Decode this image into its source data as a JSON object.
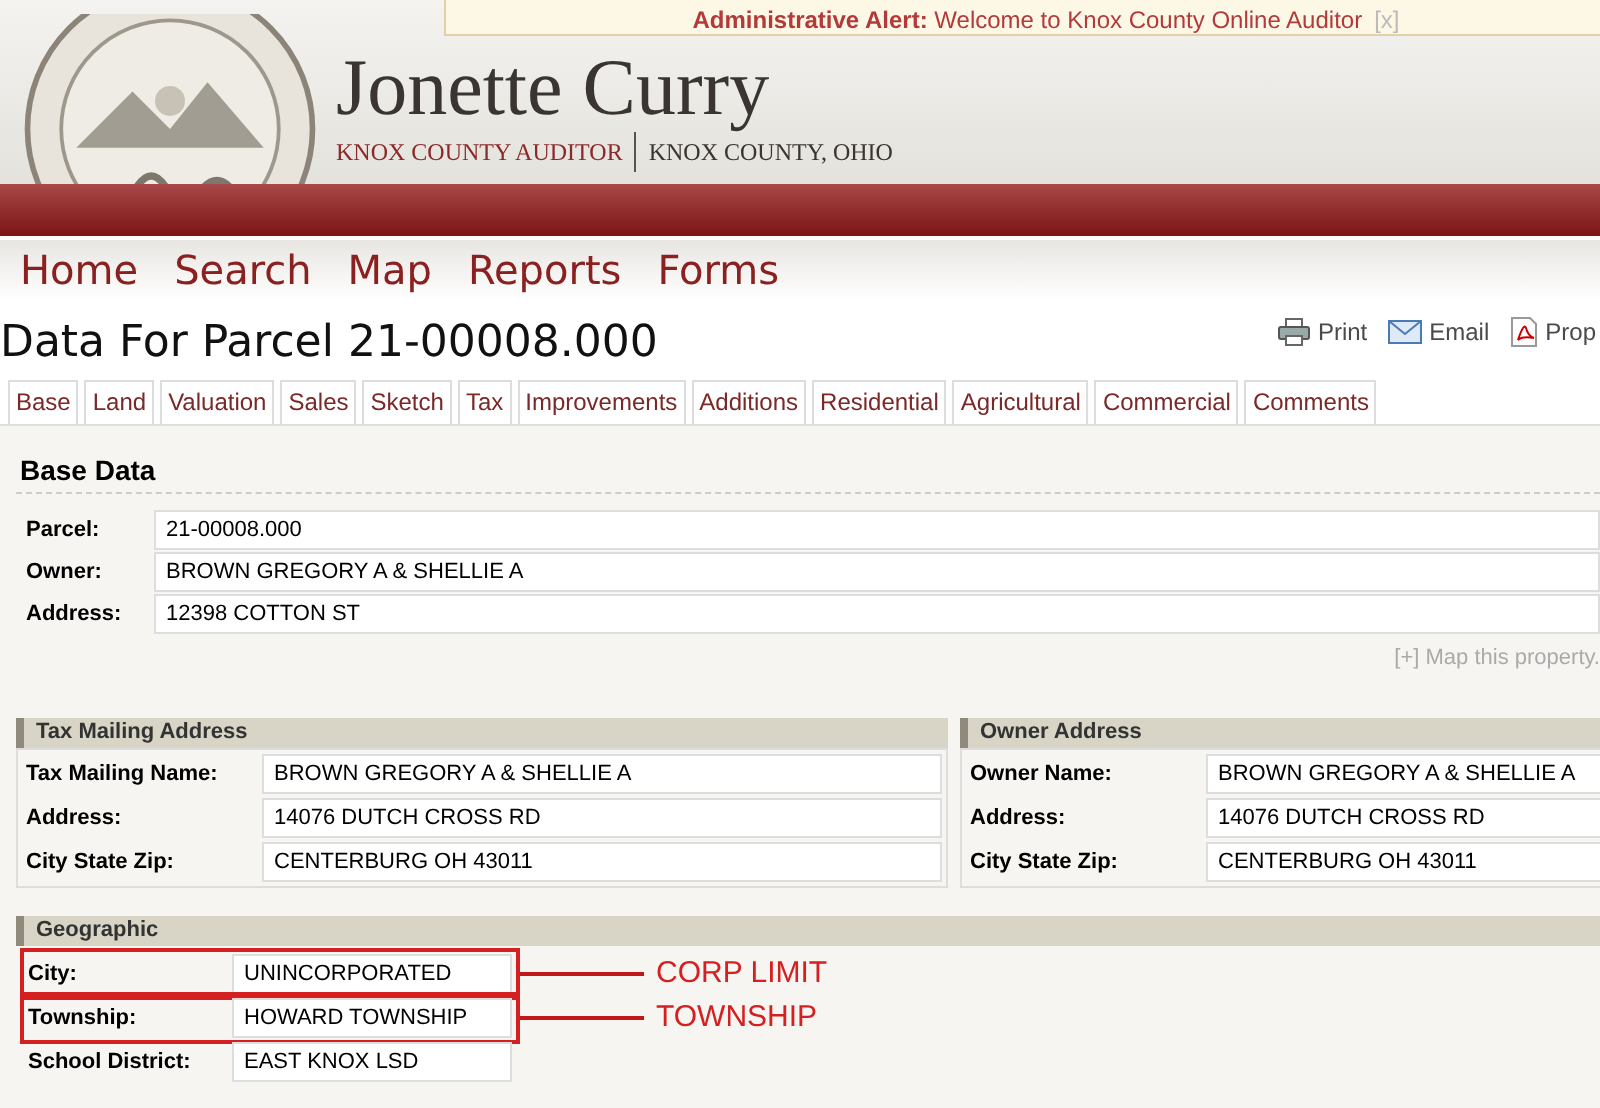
{
  "alert": {
    "label": "Administrative Alert:",
    "message": "Welcome to Knox County Online Auditor",
    "close": "[x]"
  },
  "header": {
    "name": "Jonette Curry",
    "office": "KNOX COUNTY AUDITOR",
    "county": "KNOX COUNTY, OHIO"
  },
  "nav": [
    "Home",
    "Search",
    "Map",
    "Reports",
    "Forms"
  ],
  "page_title": "Data For Parcel 21-00008.000",
  "actions": [
    {
      "kind": "print",
      "label": "Print"
    },
    {
      "kind": "email",
      "label": "Email"
    },
    {
      "kind": "pdf",
      "label": "Prop"
    }
  ],
  "tabs": [
    "Base",
    "Land",
    "Valuation",
    "Sales",
    "Sketch",
    "Tax",
    "Improvements",
    "Additions",
    "Residential",
    "Agricultural",
    "Commercial",
    "Comments"
  ],
  "base_data": {
    "title": "Base Data",
    "rows": [
      {
        "label": "Parcel:",
        "value": "21-00008.000"
      },
      {
        "label": "Owner:",
        "value": "BROWN GREGORY A & SHELLIE A"
      },
      {
        "label": "Address:",
        "value": "12398 COTTON ST"
      }
    ],
    "map_link": "[+] Map this property."
  },
  "tax_mailing": {
    "title": "Tax Mailing Address",
    "rows": [
      {
        "label": "Tax Mailing Name:",
        "value": "BROWN GREGORY A & SHELLIE A"
      },
      {
        "label": "Address:",
        "value": "14076 DUTCH CROSS RD"
      },
      {
        "label": "City State Zip:",
        "value": "CENTERBURG OH 43011"
      }
    ]
  },
  "owner_address": {
    "title": "Owner Address",
    "rows": [
      {
        "label": "Owner Name:",
        "value": "BROWN GREGORY A & SHELLIE A"
      },
      {
        "label": "Address:",
        "value": "14076 DUTCH CROSS RD"
      },
      {
        "label": "City State Zip:",
        "value": "CENTERBURG OH 43011"
      }
    ]
  },
  "geographic": {
    "title": "Geographic",
    "rows": [
      {
        "label": "City:",
        "value": "UNINCORPORATED",
        "annotation": "CORP LIMIT"
      },
      {
        "label": "Township:",
        "value": "HOWARD TOWNSHIP",
        "annotation": "TOWNSHIP"
      },
      {
        "label": "School District:",
        "value": "EAST KNOX LSD"
      }
    ]
  }
}
